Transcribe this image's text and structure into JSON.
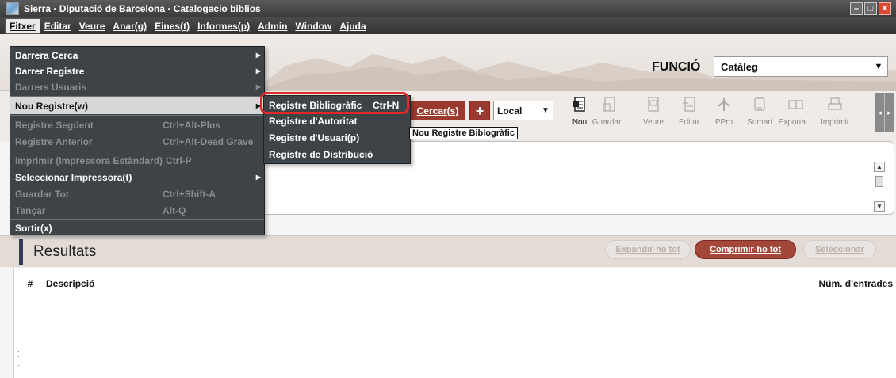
{
  "window": {
    "title": "Sierra · Diputació de Barcelona · Catalogacio biblios",
    "controls": {
      "minimize": "–",
      "maximize": "□",
      "close": "✕"
    }
  },
  "menubar": {
    "items": [
      "Fitxer",
      "Editar",
      "Veure",
      "Anar(g)",
      "Eines(t)",
      "Informes(p)",
      "Admin",
      "Window",
      "Ajuda"
    ]
  },
  "file_menu": {
    "items": [
      {
        "label": "Darrera Cerca",
        "shortcut": "",
        "state": "enabled"
      },
      {
        "label": "Darrer Registre",
        "shortcut": "",
        "state": "enabled"
      },
      {
        "label": "Darrers Usuaris",
        "shortcut": "",
        "state": "disabled"
      },
      {
        "label": "Nou Registre(w)",
        "shortcut": "",
        "state": "highlighted"
      },
      {
        "label": "Registre Següent",
        "shortcut": "Ctrl+Alt-Plus",
        "state": "disabled"
      },
      {
        "label": "Registre Anterior",
        "shortcut": "Ctrl+Alt-Dead Grave",
        "state": "disabled"
      },
      {
        "label": "Imprimir (Impressora Estàndard)",
        "shortcut": "Ctrl-P",
        "state": "disabled"
      },
      {
        "label": "Seleccionar Impressora(t)",
        "shortcut": "",
        "state": "enabled"
      },
      {
        "label": "Guardar Tot",
        "shortcut": "Ctrl+Shift-A",
        "state": "disabled"
      },
      {
        "label": "Tançar",
        "shortcut": "Alt-Q",
        "state": "disabled"
      },
      {
        "label": "Sortir(x)",
        "shortcut": "",
        "state": "enabled"
      }
    ],
    "submenu_arrow": "▶"
  },
  "submenu": {
    "items": [
      {
        "label": "Registre Bibliogràfic",
        "shortcut": "Ctrl-N"
      },
      {
        "label": "Registre d'Autoritat",
        "shortcut": ""
      },
      {
        "label": "Registre d'Usuari(p)",
        "shortcut": ""
      },
      {
        "label": "Registre de Distribució",
        "shortcut": ""
      }
    ]
  },
  "tooltip": "Nou Registre Biblogràfic",
  "funcio": {
    "label": "FUNCIÓ",
    "value": "Catàleg",
    "arrow": "▼"
  },
  "search": {
    "button": "Cercar(s)",
    "add": "+",
    "scope": "Local",
    "arrow": "▼"
  },
  "toolbar": {
    "tools": [
      {
        "label": "Nou",
        "icon": "new-record-icon",
        "enabled": true
      },
      {
        "label": "Guardar...",
        "icon": "save-icon",
        "enabled": false
      },
      {
        "label": "Veure",
        "icon": "view-icon",
        "enabled": false
      },
      {
        "label": "Editar",
        "icon": "edit-icon",
        "enabled": false
      },
      {
        "label": "PPro",
        "icon": "ppro-icon",
        "enabled": false
      },
      {
        "label": "Sumari",
        "icon": "summary-icon",
        "enabled": false
      },
      {
        "label": "Exporta...",
        "icon": "export-icon",
        "enabled": false
      },
      {
        "label": "Imprimir",
        "icon": "print-icon",
        "enabled": false
      }
    ],
    "scroll_left": "◂",
    "scroll_right": "▸"
  },
  "scrollbar": {
    "up": "▲",
    "down": "▼"
  },
  "results": {
    "title": "Resultats",
    "expand": "Expandir-ho tot",
    "collapse": "Comprimir-ho tot",
    "select": "Seleccionar",
    "columns": {
      "num": "#",
      "desc": "Descripció",
      "count": "Núm. d'entrades"
    }
  },
  "colors": {
    "accent": "#9a3a2e",
    "menu_bg": "#3d4346",
    "titlebar": "#4a4a4a",
    "highlight_ring": "#e02828"
  }
}
